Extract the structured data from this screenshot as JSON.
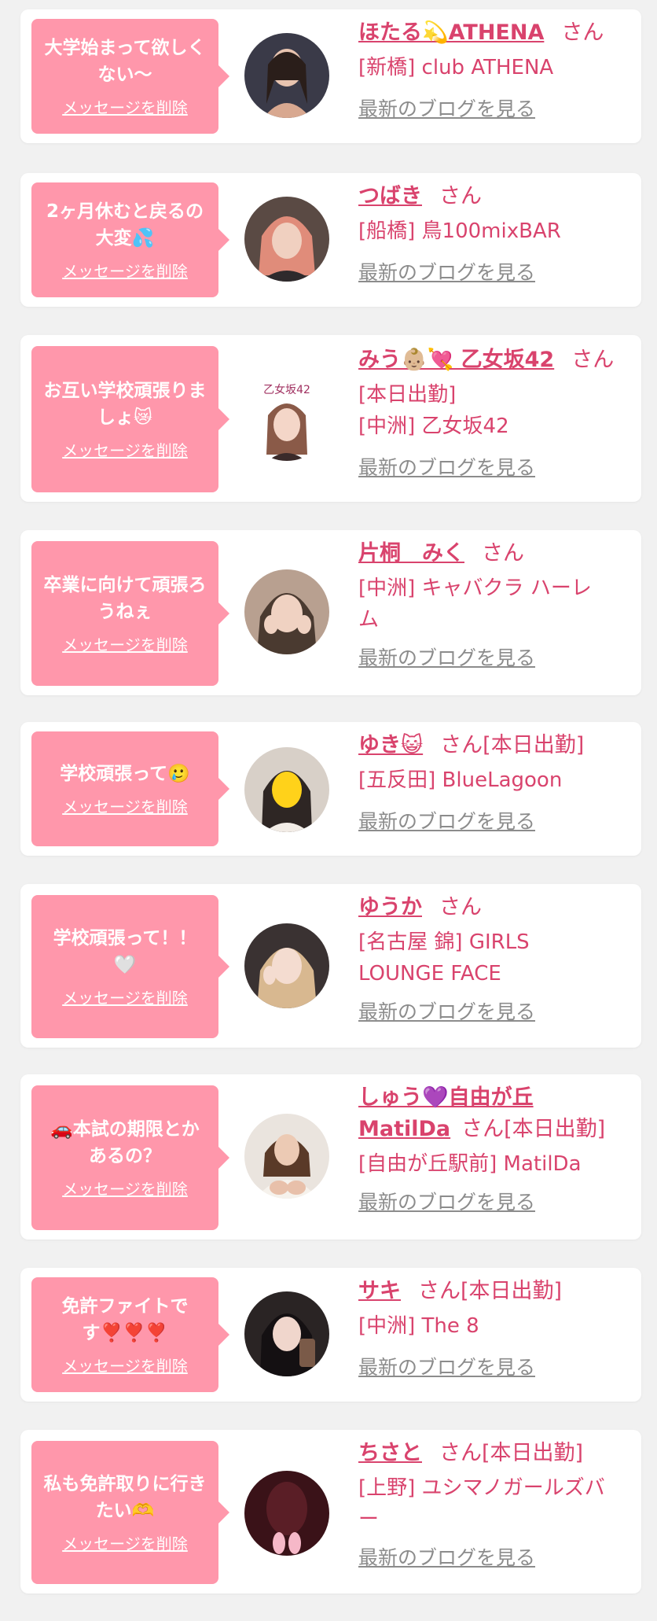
{
  "cards": [
    {
      "message": "大学始まって欲しくない〜",
      "delete_label": "メッセージを削除",
      "name": "ほたる💫ATHENA",
      "san": "さん",
      "tag": "",
      "lines": [
        "[新橋] club ATHENA"
      ],
      "blog_label": "最新のブログを見る",
      "avatar": "woman-portrait-avatar"
    },
    {
      "message": "2ヶ月休むと戻るの大変💦",
      "delete_label": "メッセージを削除",
      "name": "つばき",
      "san": "さん",
      "tag": "",
      "lines": [
        "[船橋] 鳥100mixBAR"
      ],
      "blog_label": "最新のブログを見る",
      "avatar": "woman-portrait-avatar"
    },
    {
      "message": "お互い学校頑張りましょ😿",
      "delete_label": "メッセージを削除",
      "name": "みう👶🏼💘 乙女坂42",
      "san": "さん",
      "tag": "",
      "lines": [
        "[本日出勤]",
        "[中洲] 乙女坂42"
      ],
      "blog_label": "最新のブログを見る",
      "avatar": "woman-portrait-avatar"
    },
    {
      "message": "卒業に向けて頑張ろうねぇ",
      "delete_label": "メッセージを削除",
      "name": "片桐　みく",
      "san": "さん",
      "tag": "",
      "lines": [
        "[中洲] キャバクラ ハーレ",
        "ム"
      ],
      "blog_label": "最新のブログを見る",
      "avatar": "woman-portrait-avatar"
    },
    {
      "message": "学校頑張って🥲",
      "delete_label": "メッセージを削除",
      "name": "ゆき😺",
      "san": "さん",
      "tag": "[本日出勤]",
      "lines": [
        "[五反田] BlueLagoon"
      ],
      "blog_label": "最新のブログを見る",
      "avatar": "woman-portrait-avatar"
    },
    {
      "message": "学校頑張って！！🤍",
      "delete_label": "メッセージを削除",
      "name": "ゆうか",
      "san": "さん",
      "tag": "",
      "lines": [
        "[名古屋 錦] GIRLS",
        "LOUNGE FACE"
      ],
      "blog_label": "最新のブログを見る",
      "avatar": "woman-portrait-avatar"
    },
    {
      "message": "🚗本試の期限とかあるの？",
      "delete_label": "メッセージを削除",
      "name": "しゅう💜自由が丘",
      "name2": "MatilDa",
      "san": "さん",
      "tag": "[本日出勤]",
      "lines": [
        "[自由が丘駅前] MatilDa"
      ],
      "blog_label": "最新のブログを見る",
      "avatar": "woman-portrait-avatar"
    },
    {
      "message": "免許ファイトです❣️❣️❣️",
      "delete_label": "メッセージを削除",
      "name": "サキ",
      "san": "さん",
      "tag": "[本日出勤]",
      "lines": [
        "[中洲] The 8"
      ],
      "blog_label": "最新のブログを見る",
      "avatar": "woman-portrait-avatar"
    },
    {
      "message": "私も免許取りに行きたい🫶",
      "delete_label": "メッセージを削除",
      "name": "ちさと",
      "san": "さん",
      "tag": "[本日出勤]",
      "lines": [
        "[上野] ユシマノガールズバ",
        "ー"
      ],
      "blog_label": "最新のブログを見る",
      "avatar": "woman-portrait-avatar"
    }
  ]
}
